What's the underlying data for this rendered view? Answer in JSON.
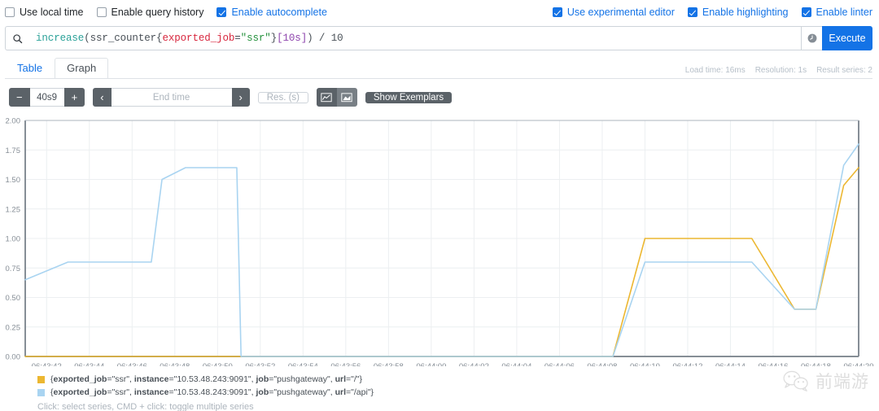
{
  "options_bar": {
    "left": [
      {
        "label": "Use local time",
        "checked": false,
        "name": "use-local-time"
      },
      {
        "label": "Enable query history",
        "checked": false,
        "name": "enable-query-history"
      },
      {
        "label": "Enable autocomplete",
        "checked": true,
        "name": "enable-autocomplete"
      }
    ],
    "right": [
      {
        "label": "Use experimental editor",
        "checked": true,
        "name": "use-experimental-editor"
      },
      {
        "label": "Enable highlighting",
        "checked": true,
        "name": "enable-highlighting"
      },
      {
        "label": "Enable linter",
        "checked": true,
        "name": "enable-linter"
      }
    ]
  },
  "query": {
    "icon": "search-icon",
    "history_icon": "history-clock-icon",
    "execute_label": "Execute",
    "expression": "increase(ssr_counter{exported_job=\"ssr\"}[10s]) / 10",
    "tokens": [
      {
        "text": "increase",
        "type": "fn"
      },
      {
        "text": "(ssr_counter{",
        "type": "plain"
      },
      {
        "text": "exported_job",
        "type": "label"
      },
      {
        "text": "=",
        "type": "plain"
      },
      {
        "text": "\"ssr\"",
        "type": "str"
      },
      {
        "text": "}",
        "type": "plain"
      },
      {
        "text": "[10s]",
        "type": "dur"
      },
      {
        "text": ") / ",
        "type": "plain"
      },
      {
        "text": "10",
        "type": "num"
      }
    ]
  },
  "tabs": [
    {
      "label": "Table",
      "active": false,
      "name": "tab-table"
    },
    {
      "label": "Graph",
      "active": true,
      "name": "tab-graph"
    }
  ],
  "meta": {
    "load_time": "Load time: 16ms",
    "resolution": "Resolution: 1s",
    "result_series": "Result series: 2"
  },
  "controls": {
    "decrease_range": "−",
    "range_value": "40s9",
    "increase_range": "+",
    "prev_arrow": "‹",
    "end_time_placeholder": "End time",
    "next_arrow": "›",
    "resolution_placeholder": "Res. (s)",
    "line_chart_icon": "line-chart-icon",
    "stacked_chart_icon": "stacked-chart-icon",
    "show_exemplars_label": "Show Exemplars"
  },
  "legend": {
    "items": [
      {
        "color": "#ecb731",
        "name": "legend-item-url-root",
        "parts": [
          {
            "t": "{",
            "b": false
          },
          {
            "t": "exported_job",
            "b": true
          },
          {
            "t": "=\"ssr\", ",
            "b": false
          },
          {
            "t": "instance",
            "b": true
          },
          {
            "t": "=\"10.53.48.243:9091\", ",
            "b": false
          },
          {
            "t": "job",
            "b": true
          },
          {
            "t": "=\"pushgateway\", ",
            "b": false
          },
          {
            "t": "url",
            "b": true
          },
          {
            "t": "=\"/\"}",
            "b": false
          }
        ]
      },
      {
        "color": "#a9d4f1",
        "name": "legend-item-url-api",
        "parts": [
          {
            "t": "{",
            "b": false
          },
          {
            "t": "exported_job",
            "b": true
          },
          {
            "t": "=\"ssr\", ",
            "b": false
          },
          {
            "t": "instance",
            "b": true
          },
          {
            "t": "=\"10.53.48.243:9091\", ",
            "b": false
          },
          {
            "t": "job",
            "b": true
          },
          {
            "t": "=\"pushgateway\", ",
            "b": false
          },
          {
            "t": "url",
            "b": true
          },
          {
            "t": "=\"/api\"}",
            "b": false
          }
        ]
      }
    ],
    "hint": "Click: select series, CMD + click: toggle multiple series"
  },
  "watermark": {
    "text": "前端游",
    "icon": "wechat-icon"
  },
  "chart_data": {
    "type": "line",
    "title": "",
    "xlabel": "",
    "ylabel": "",
    "ylim": [
      0,
      2.0
    ],
    "y_ticks": [
      "0.00",
      "0.25",
      "0.50",
      "0.75",
      "1.00",
      "1.25",
      "1.50",
      "1.75",
      "2.00"
    ],
    "y_tick_values": [
      0,
      0.25,
      0.5,
      0.75,
      1.0,
      1.25,
      1.5,
      1.75,
      2.0
    ],
    "x_ticks": [
      "06:43:42",
      "06:43:44",
      "06:43:46",
      "06:43:48",
      "06:43:50",
      "06:43:52",
      "06:43:54",
      "06:43:56",
      "06:43:58",
      "06:44:00",
      "06:44:02",
      "06:44:04",
      "06:44:06",
      "06:44:08",
      "06:44:10",
      "06:44:12",
      "06:44:14",
      "06:44:16",
      "06:44:18",
      "06:44:20"
    ],
    "xlim": [
      0,
      39
    ],
    "grid": true,
    "legend_position": "bottom",
    "series": [
      {
        "name": "{exported_job=\"ssr\", instance=\"10.53.48.243:9091\", job=\"pushgateway\", url=\"/\"}",
        "color": "#ecb731",
        "x": [
          0,
          27.5,
          29.0,
          34.0,
          36.0,
          37.0,
          38.3,
          39.0
        ],
        "values": [
          0,
          0,
          1.0,
          1.0,
          0.4,
          0.4,
          1.45,
          1.6
        ]
      },
      {
        "name": "{exported_job=\"ssr\", instance=\"10.53.48.243:9091\", job=\"pushgateway\", url=\"/api\"}",
        "color": "#a9d4f1",
        "x": [
          0,
          2.0,
          5.9,
          6.4,
          7.5,
          9.9,
          10.1,
          27.5,
          29.0,
          34.0,
          36.0,
          37.0,
          38.3,
          39.0
        ],
        "values": [
          0.65,
          0.8,
          0.8,
          1.5,
          1.6,
          1.6,
          0,
          0,
          0.8,
          0.8,
          0.4,
          0.4,
          1.62,
          1.8
        ]
      }
    ]
  }
}
